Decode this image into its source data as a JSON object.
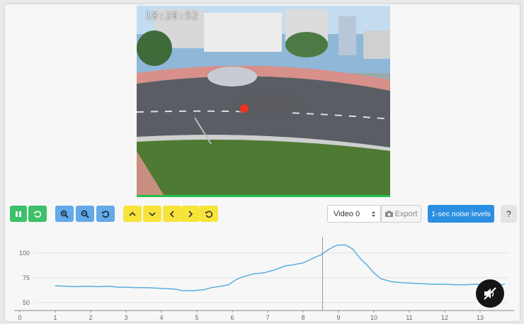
{
  "video": {
    "timestamp": "18:20:52"
  },
  "controls": {
    "pause_icon": "pause-icon",
    "restart_icon": "restart-icon",
    "zoom_in_icon": "zoom-in-icon",
    "zoom_out_icon": "zoom-out-icon",
    "zoom_reset_icon": "zoom-reset-icon",
    "pan_up_icon": "chevron-up-icon",
    "pan_down_icon": "chevron-down-icon",
    "pan_left_icon": "chevron-left-icon",
    "pan_right_icon": "chevron-right-icon",
    "pan_reset_icon": "pan-reset-icon"
  },
  "toolbar": {
    "video_select": "Video 0",
    "export_label": "Export",
    "noise_label": "1-sec noise levels",
    "help_label": "?"
  },
  "colors": {
    "green": "#3cc06a",
    "blue": "#64a9e8",
    "yellow": "#f7e43a",
    "primary": "#2a8fe0",
    "line": "#5aaee0"
  },
  "chart_data": {
    "type": "line",
    "title": "",
    "xlabel": "",
    "ylabel": "",
    "xlim": [
      0,
      13.8
    ],
    "ylim": [
      42,
      112
    ],
    "xticks": [
      0,
      1,
      2,
      3,
      4,
      5,
      6,
      7,
      8,
      9,
      10,
      11,
      12,
      13
    ],
    "yticks": [
      50,
      75,
      100
    ],
    "cursor_x": 8.55,
    "series": [
      {
        "x": [
          1.0,
          1.3,
          1.6,
          1.9,
          2.2,
          2.5,
          2.8,
          3.0,
          3.3,
          3.6,
          3.9,
          4.2,
          4.4,
          4.6,
          4.9,
          5.2,
          5.4,
          5.6,
          5.9,
          6.1,
          6.3,
          6.6,
          6.9,
          7.2,
          7.5,
          7.7,
          8.0,
          8.3,
          8.5,
          8.7,
          8.9,
          9.0,
          9.2,
          9.4,
          9.6,
          9.8,
          10.0,
          10.2,
          10.5,
          10.8,
          11.1,
          11.4,
          11.7,
          12.0,
          12.3,
          12.6,
          12.9,
          13.2,
          13.5,
          13.7
        ],
        "y": [
          67,
          66.5,
          66,
          66.5,
          66,
          66.5,
          65.5,
          65.5,
          65,
          65,
          64.5,
          64,
          63.5,
          62,
          62,
          63,
          65,
          66,
          68,
          73,
          76,
          79,
          80,
          83,
          87,
          88,
          90,
          95,
          98,
          103,
          107,
          108,
          108,
          104,
          95,
          88,
          80,
          74,
          71,
          70,
          69.5,
          69,
          68.5,
          68.5,
          68,
          68,
          68.5,
          68,
          68,
          68.5
        ]
      }
    ]
  }
}
